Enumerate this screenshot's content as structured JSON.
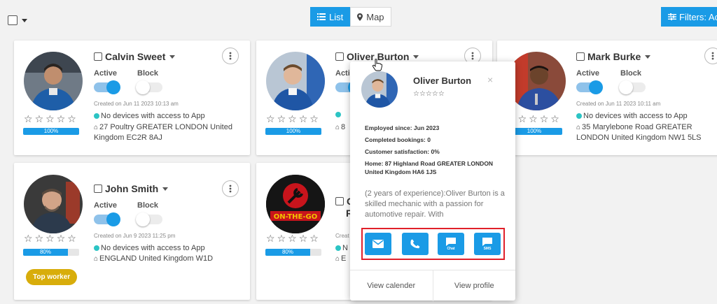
{
  "toolbar": {
    "views": [
      {
        "label": "List",
        "active": true
      },
      {
        "label": "Map",
        "active": false
      }
    ],
    "filters_label": "Filters: Act"
  },
  "workers": [
    {
      "name": "Calvin Sweet",
      "active_label": "Active",
      "block_label": "Block",
      "active": true,
      "blocked": false,
      "created": "Created on Jun 11 2023 10:13 am",
      "devices": "No devices with access to App",
      "address": "27 Poultry GREATER LONDON United Kingdom EC2R 8AJ",
      "progress": 100,
      "progress_label": "100%"
    },
    {
      "name": "Oliver Burton",
      "active_label": "Acti",
      "block_label": "",
      "active": true,
      "blocked": false,
      "created": "",
      "devices": "",
      "address": "8",
      "progress": 100,
      "progress_label": "100%"
    },
    {
      "name": "Mark Burke",
      "active_label": "Active",
      "block_label": "Block",
      "active": true,
      "blocked": false,
      "created": "Created on Jun 11 2023 10:11 am",
      "devices": "No devices with access to App",
      "address": "35 Marylebone Road GREATER LONDON United Kingdom NW1 5LS",
      "progress": 100,
      "progress_label": "100%"
    },
    {
      "name": "John Smith",
      "active_label": "Active",
      "block_label": "Block",
      "active": true,
      "blocked": false,
      "created": "Created on Jun 9 2023 11:25 pm",
      "devices": "No devices with access to App",
      "address": "ENGLAND United Kingdom W1D",
      "progress": 80,
      "progress_label": "80%",
      "badge": "Top worker"
    },
    {
      "name": "G",
      "name_line2": "R",
      "active_label": "",
      "block_label": "",
      "active": false,
      "blocked": false,
      "created": "Creat",
      "devices": "N",
      "address": "E",
      "progress": 80,
      "progress_label": "80%",
      "logo_text": "ON-THE-GO"
    }
  ],
  "popover": {
    "name": "Oliver Burton",
    "stars": "☆☆☆☆☆",
    "close": "×",
    "employed": "Employed since: Jun 2023",
    "bookings": "Completed bookings: 0",
    "satisfaction": "Customer satisfaction: 0%",
    "home": "Home: 87 Highland Road GREATER LONDON United Kingdom HA6 1JS",
    "bio": "(2 years of experience):Oliver Burton is a skilled mechanic with a passion for automotive repair. With",
    "actions": [
      {
        "icon": "email-icon",
        "label": ""
      },
      {
        "icon": "phone-icon",
        "label": ""
      },
      {
        "icon": "chat-icon",
        "label": "Chat"
      },
      {
        "icon": "sms-icon",
        "label": "SMS"
      }
    ],
    "view_calendar": "View calender",
    "view_profile": "View profile"
  },
  "stars_glyph": "☆",
  "icon_glyphs": {
    "home": "⌂"
  },
  "colors": {
    "primary": "#1a9be6",
    "badge": "#d8ad0b",
    "highlight": "#e0202a",
    "device_dot": "#2cc4c4"
  }
}
